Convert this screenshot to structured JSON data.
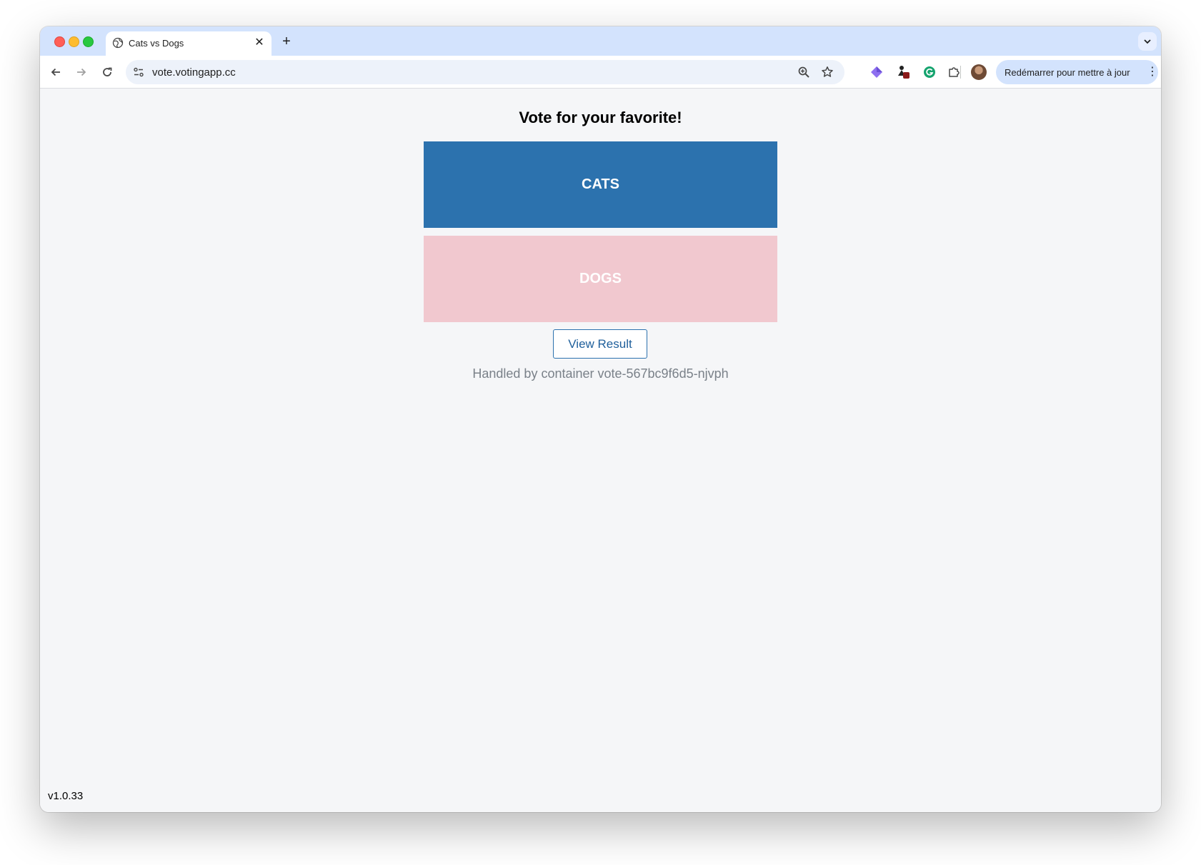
{
  "browser": {
    "tab": {
      "title": "Cats vs Dogs",
      "favicon": "globe-icon",
      "close_icon": "close-icon"
    },
    "new_tab_icon": "plus-icon",
    "tab_search_icon": "chevron-down-icon",
    "toolbar": {
      "back_icon": "back-arrow-icon",
      "forward_icon": "forward-arrow-icon",
      "reload_icon": "reload-icon",
      "url": "vote.votingapp.cc",
      "relaunch_label": "Redémarrer pour mettre à jour",
      "extensions": [
        "gem-icon",
        "puppet-extension-icon",
        "grammarly-icon",
        "puzzle-icon"
      ]
    }
  },
  "page": {
    "heading": "Vote for your favorite!",
    "options": [
      {
        "label": "CATS",
        "color": "#2c72ae"
      },
      {
        "label": "DOGS",
        "color": "#f1c8cf"
      }
    ],
    "view_result_label": "View Result",
    "handled_by": "Handled by container vote-567bc9f6d5-njvph",
    "version": "v1.0.33"
  }
}
